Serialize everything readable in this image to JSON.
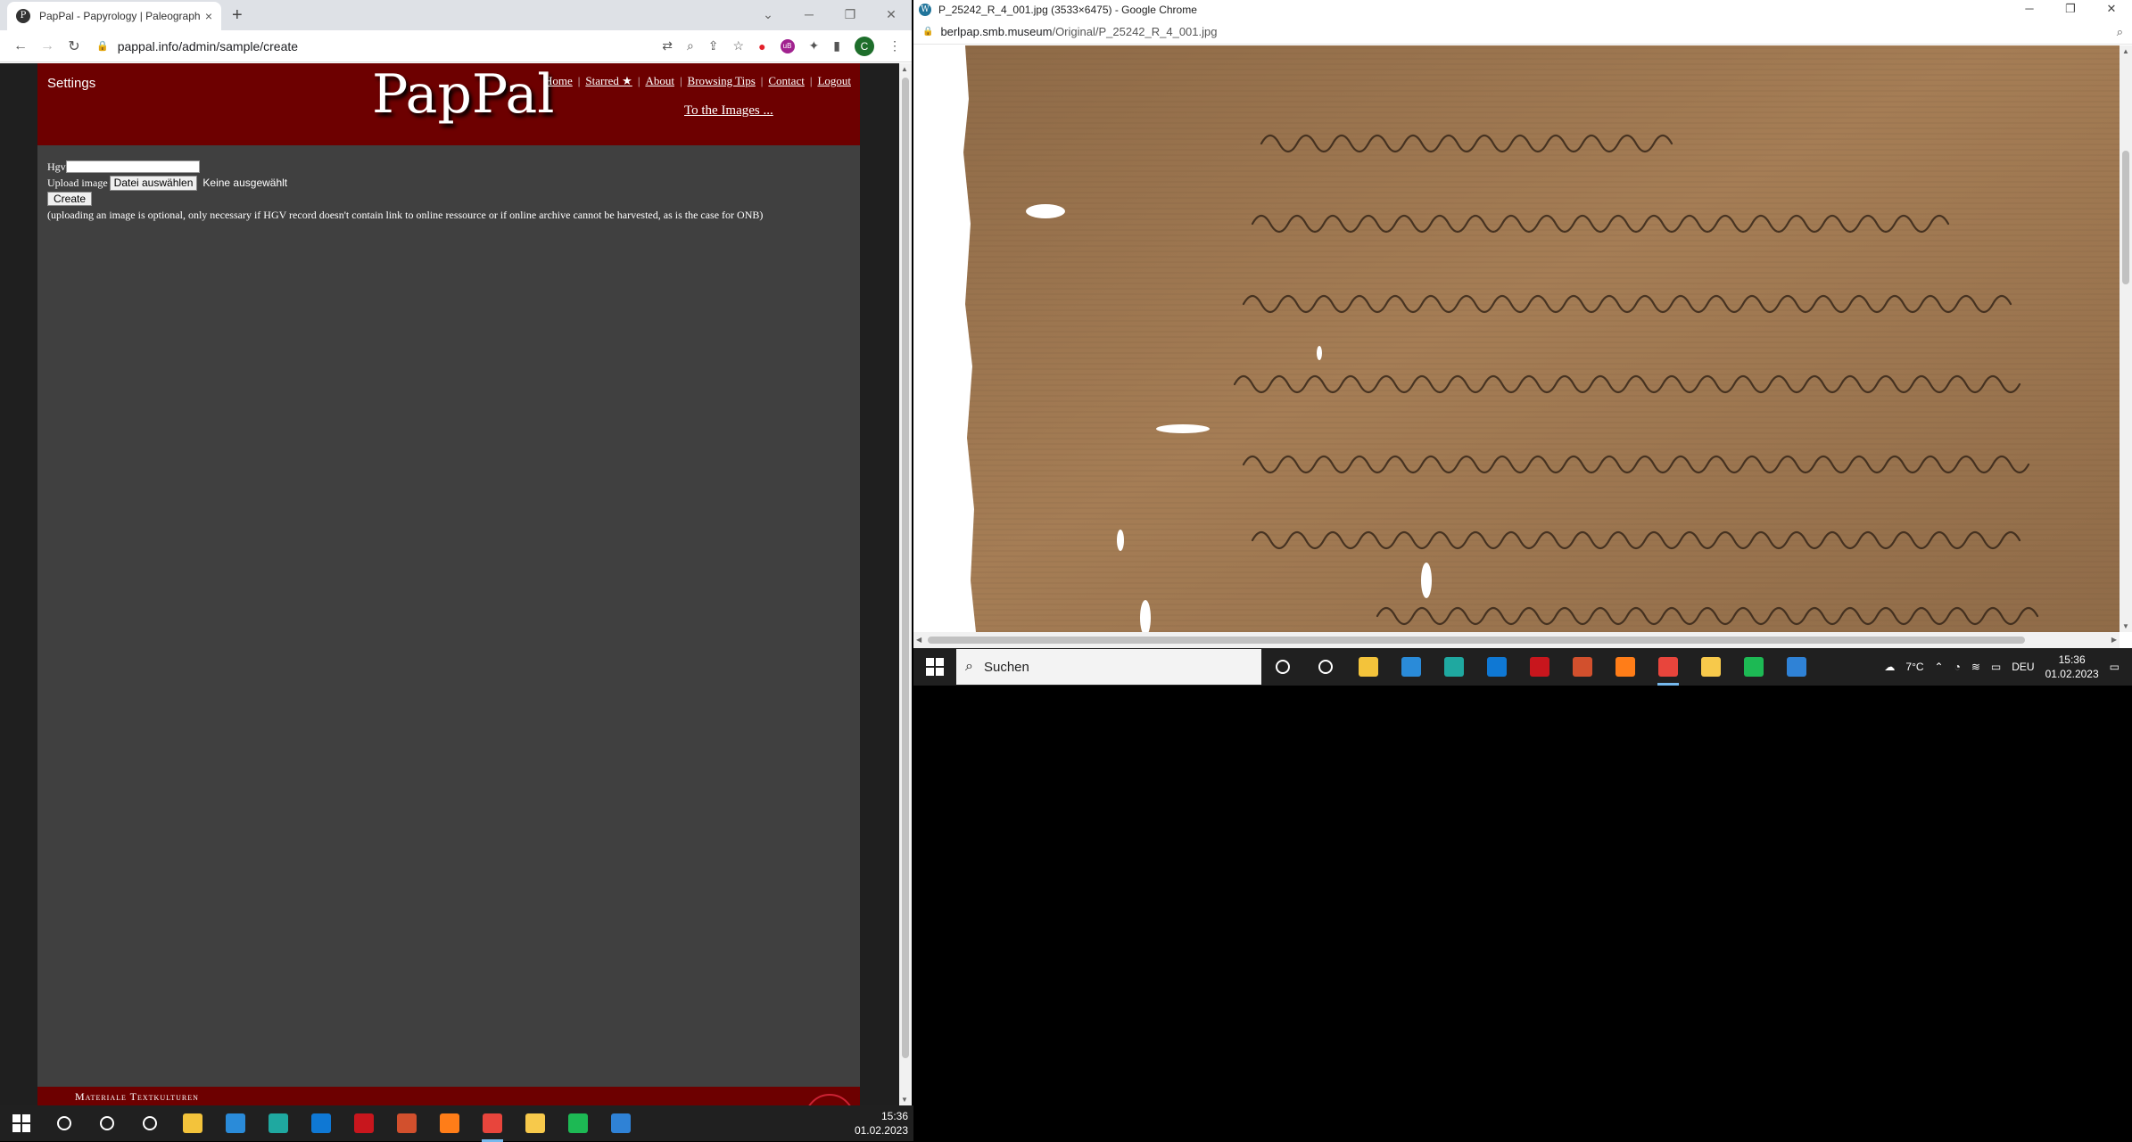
{
  "left_window": {
    "tab": {
      "favicon": "P",
      "title": "PapPal - Papyrology | Paleograph",
      "close": "×"
    },
    "new_tab": "+",
    "window_controls": [
      "⌄",
      "─",
      "❐",
      "✕"
    ],
    "nav": {
      "back": "←",
      "forward": "→",
      "reload": "↻"
    },
    "address": "pappal.info/admin/sample/create",
    "profile_initial": "C"
  },
  "page": {
    "settings_label": "Settings",
    "logo": "PapPal",
    "nav_links": [
      {
        "label": "Home"
      },
      {
        "label": "Starred ★"
      },
      {
        "label": "About"
      },
      {
        "label": "Browsing Tips"
      },
      {
        "label": "Contact"
      },
      {
        "label": "Logout"
      }
    ],
    "nav_separator": "|",
    "to_images": "To the Images ...",
    "form": {
      "hgv_label": "Hgv",
      "hgv_value": "",
      "upload_label": "Upload image",
      "file_button": "Datei auswählen",
      "file_status": "Keine ausgewählt",
      "create_button": "Create",
      "note": "(uploading an image is optional, only necessary if HGV record doesn't contain link to online ressource or if online archive cannot be harvested, as is the case for ONB)"
    },
    "footer_text": "Materiale Textkulturen"
  },
  "right_window": {
    "title": "P_25242_R_4_001.jpg (3533×6475) - Google Chrome",
    "favicon": "W",
    "address_host": "berlpap.smb.museum",
    "address_path": "/Original/P_25242_R_4_001.jpg",
    "window_controls": [
      "─",
      "❐",
      "✕"
    ]
  },
  "right_taskbar": {
    "search_placeholder": "Suchen",
    "weather": "7°C",
    "language": "DEU",
    "time": "15:36",
    "date": "01.02.2023",
    "apps": [
      {
        "name": "cortana",
        "color": "#202020"
      },
      {
        "name": "task-view",
        "color": "#202020"
      },
      {
        "name": "file-explorer",
        "color": "#f3c33b"
      },
      {
        "name": "microsoft-store",
        "color": "#2a8bd9"
      },
      {
        "name": "edge",
        "color": "#1fa8a0"
      },
      {
        "name": "mail",
        "color": "#0f78d4"
      },
      {
        "name": "acrobat",
        "color": "#c8161d"
      },
      {
        "name": "powerpoint",
        "color": "#d2502d"
      },
      {
        "name": "firefox",
        "color": "#ff7d18"
      },
      {
        "name": "chrome",
        "color": "#e8453c"
      },
      {
        "name": "sticky-app",
        "color": "#f7c94b"
      },
      {
        "name": "spotify",
        "color": "#1db954"
      },
      {
        "name": "photos",
        "color": "#2f82d6"
      }
    ]
  },
  "left_taskbar": {
    "time": "15:36",
    "date": "01.02.2023",
    "apps": [
      {
        "name": "search",
        "color": "#202020"
      },
      {
        "name": "cortana",
        "color": "#202020"
      },
      {
        "name": "task-view",
        "color": "#202020"
      },
      {
        "name": "file-explorer",
        "color": "#f3c33b"
      },
      {
        "name": "microsoft-store",
        "color": "#2a8bd9"
      },
      {
        "name": "edge",
        "color": "#1fa8a0"
      },
      {
        "name": "mail",
        "color": "#0f78d4"
      },
      {
        "name": "acrobat",
        "color": "#c8161d"
      },
      {
        "name": "powerpoint",
        "color": "#d2502d"
      },
      {
        "name": "firefox",
        "color": "#ff7d18"
      },
      {
        "name": "chrome",
        "color": "#e8453c"
      },
      {
        "name": "sticky-app",
        "color": "#f7c94b"
      },
      {
        "name": "spotify",
        "color": "#1db954"
      },
      {
        "name": "photos",
        "color": "#2f82d6"
      }
    ]
  },
  "colors": {
    "header_red": "#6d0000",
    "page_grey": "#404040",
    "papyrus": "#9c7550"
  }
}
